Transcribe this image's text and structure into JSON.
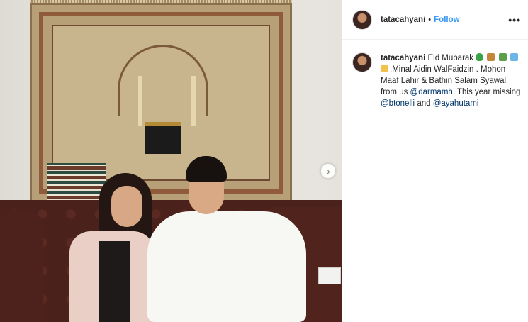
{
  "post": {
    "next_icon": "chevron-right-icon"
  },
  "header": {
    "username": "tatacahyani",
    "separator": "•",
    "follow_label": "Follow",
    "more_icon": "•••"
  },
  "caption": {
    "username": "tatacahyani",
    "text_1": "Eid Mubarak",
    "emojis": [
      "green-heart-icon",
      "camel-icon",
      "palm-tree-icon",
      "mosque-icon",
      "folded-hands-icon"
    ],
    "text_2": ".Minal Aidin WalFaidzin . Mohon Maaf Lahir & Bathin Salam Syawal from us",
    "mention_1": "@darmamh",
    "text_3": ". This year missing",
    "mention_2": "@btonelli",
    "text_4": "and",
    "mention_3": "@ayahutami"
  },
  "colors": {
    "accent": "#3897f0",
    "mention": "#003569",
    "text": "#262626"
  }
}
